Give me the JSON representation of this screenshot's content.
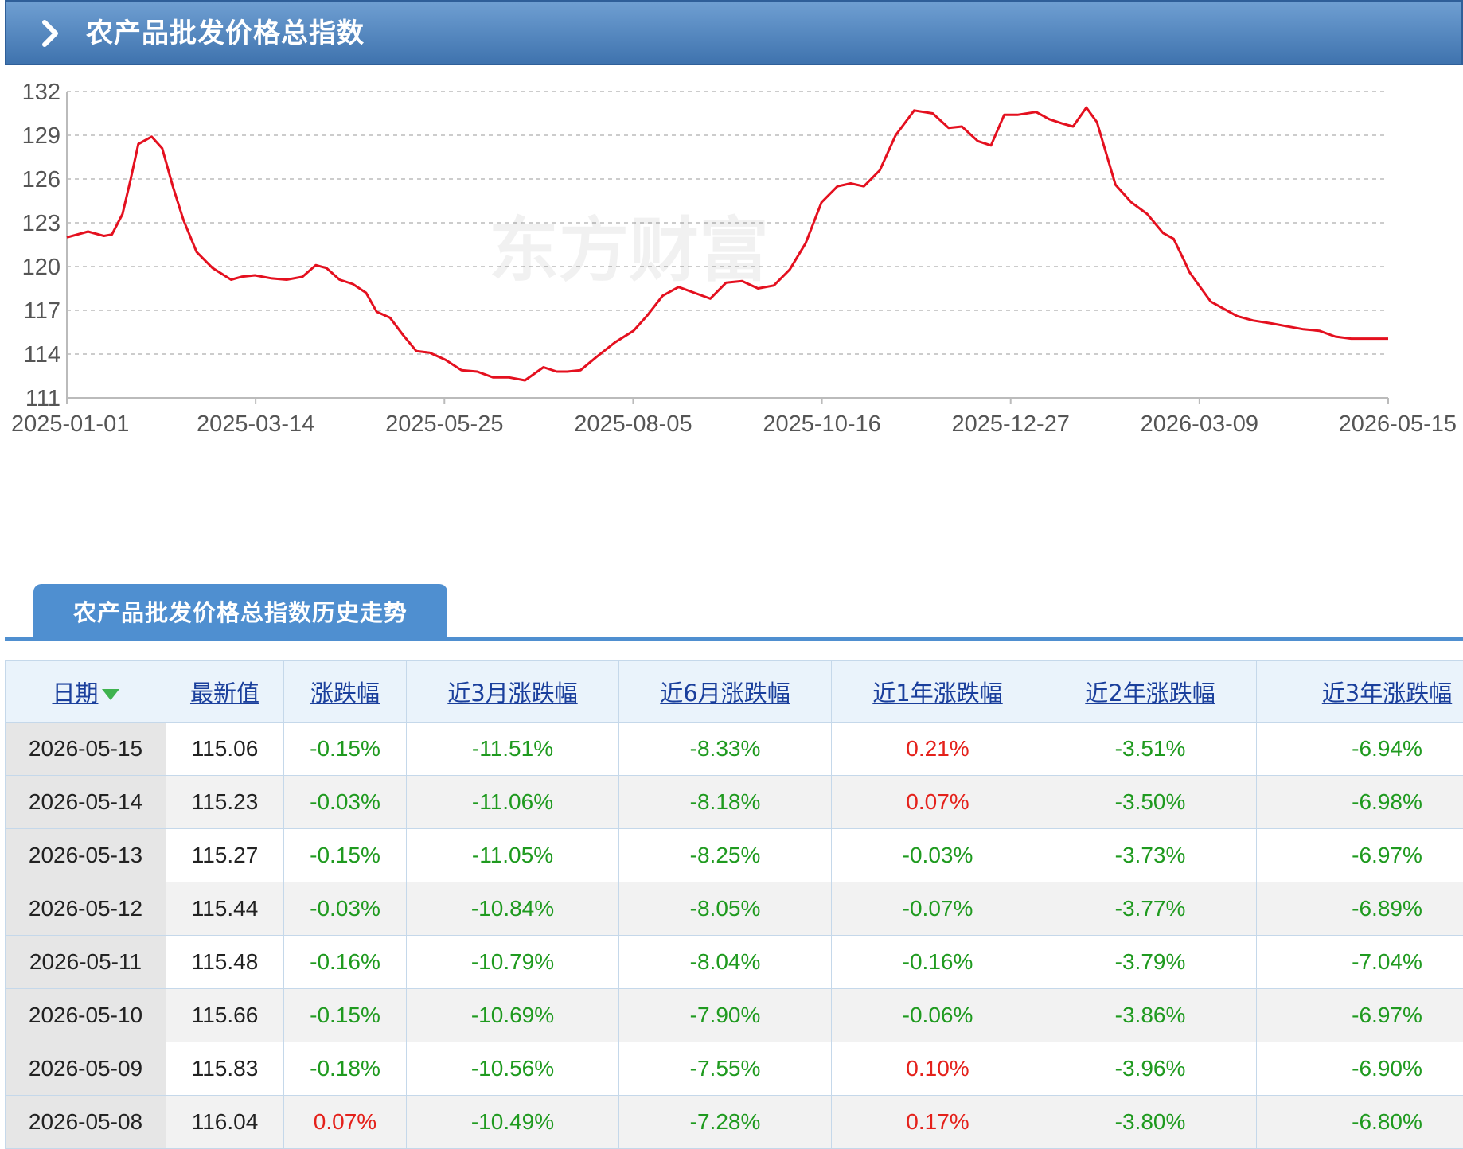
{
  "header": {
    "title": "农产品批发价格总指数"
  },
  "chart_data": {
    "type": "line",
    "title": "",
    "xlabel": "",
    "ylabel": "",
    "ylim": [
      111,
      132
    ],
    "yticks": [
      111,
      114,
      117,
      120,
      123,
      126,
      129,
      132
    ],
    "xticks": [
      "2025-01-01",
      "2025-03-14",
      "2025-05-25",
      "2025-08-05",
      "2025-10-16",
      "2025-12-27",
      "2026-03-09",
      "2026-05-15"
    ],
    "xlim": [
      "2025-01-01",
      "2026-05-15"
    ],
    "grid": true,
    "color": "#e4101f",
    "watermark": "东方财富",
    "series": [
      {
        "x": [
          "2025-01-01",
          "2025-01-09",
          "2025-01-15",
          "2025-01-18",
          "2025-01-22",
          "2025-01-25",
          "2025-01-28",
          "2025-02-02",
          "2025-02-06",
          "2025-02-10",
          "2025-02-14",
          "2025-02-19",
          "2025-02-25",
          "2025-03-04",
          "2025-03-08",
          "2025-03-13",
          "2025-03-19",
          "2025-03-25",
          "2025-03-31",
          "2025-04-05",
          "2025-04-09",
          "2025-04-14",
          "2025-04-19",
          "2025-04-24",
          "2025-04-28",
          "2025-05-03",
          "2025-05-08",
          "2025-05-13",
          "2025-05-18",
          "2025-05-24",
          "2025-05-30",
          "2025-06-05",
          "2025-06-11",
          "2025-06-17",
          "2025-06-23",
          "2025-06-30",
          "2025-07-05",
          "2025-07-09",
          "2025-07-14",
          "2025-07-20",
          "2025-07-27",
          "2025-08-03",
          "2025-08-08",
          "2025-08-14",
          "2025-08-20",
          "2025-08-26",
          "2025-09-01",
          "2025-09-07",
          "2025-09-13",
          "2025-09-19",
          "2025-09-25",
          "2025-10-01",
          "2025-10-07",
          "2025-10-13",
          "2025-10-19",
          "2025-10-24",
          "2025-10-29",
          "2025-11-04",
          "2025-11-10",
          "2025-11-17",
          "2025-11-24",
          "2025-11-30",
          "2025-12-05",
          "2025-12-11",
          "2025-12-16",
          "2025-12-21",
          "2025-12-26",
          "2026-01-02",
          "2026-01-07",
          "2026-01-12",
          "2026-01-16",
          "2026-01-21",
          "2026-01-25",
          "2026-02-01",
          "2026-02-07",
          "2026-02-13",
          "2026-02-19",
          "2026-02-23",
          "2026-02-27",
          "2026-03-01",
          "2026-03-05",
          "2026-03-09",
          "2026-03-14",
          "2026-03-19",
          "2026-03-25",
          "2026-04-01",
          "2026-04-07",
          "2026-04-13",
          "2026-04-19",
          "2026-04-25",
          "2026-05-01",
          "2026-05-06",
          "2026-05-10",
          "2026-05-15"
        ],
        "y": [
          122.0,
          122.4,
          122.1,
          122.2,
          123.6,
          125.9,
          128.4,
          128.9,
          128.1,
          125.5,
          123.2,
          121.0,
          119.9,
          119.1,
          119.3,
          119.4,
          119.2,
          119.1,
          119.3,
          120.1,
          119.9,
          119.1,
          118.8,
          118.2,
          116.9,
          116.5,
          115.3,
          114.2,
          114.1,
          113.6,
          112.9,
          112.8,
          112.4,
          112.4,
          112.2,
          113.1,
          112.8,
          112.8,
          112.9,
          113.8,
          114.8,
          115.6,
          116.6,
          118.0,
          118.6,
          118.2,
          117.8,
          118.9,
          119.0,
          118.5,
          118.7,
          119.8,
          121.6,
          124.4,
          125.5,
          125.7,
          125.5,
          126.6,
          129.0,
          130.7,
          130.5,
          129.5,
          129.6,
          128.6,
          128.3,
          130.4,
          130.4,
          130.6,
          130.1,
          129.8,
          129.6,
          130.9,
          129.9,
          125.6,
          124.4,
          123.6,
          122.3,
          121.9,
          120.4,
          119.6,
          118.6,
          117.6,
          117.1,
          116.6,
          116.3,
          116.1,
          115.9,
          115.7,
          115.6,
          115.2,
          115.06,
          115.06,
          115.06,
          115.06
        ]
      }
    ]
  },
  "tab": {
    "label": "农产品批发价格总指数历史走势"
  },
  "table": {
    "headers": [
      "日期",
      "最新值",
      "涨跌幅",
      "近3月涨跌幅",
      "近6月涨跌幅",
      "近1年涨跌幅",
      "近2年涨跌幅",
      "近3年涨跌幅"
    ],
    "sort_icon": "sort-down-arrow-icon",
    "colors": {
      "down": "#1f9a1f",
      "up": "#e4211b"
    },
    "rows": [
      {
        "date": "2026-05-15",
        "value": "115.06",
        "c1": "-0.15%",
        "c3m": "-11.51%",
        "c6m": "-8.33%",
        "c1y": "0.21%",
        "c2y": "-3.51%",
        "c3y": "-6.94%"
      },
      {
        "date": "2026-05-14",
        "value": "115.23",
        "c1": "-0.03%",
        "c3m": "-11.06%",
        "c6m": "-8.18%",
        "c1y": "0.07%",
        "c2y": "-3.50%",
        "c3y": "-6.98%"
      },
      {
        "date": "2026-05-13",
        "value": "115.27",
        "c1": "-0.15%",
        "c3m": "-11.05%",
        "c6m": "-8.25%",
        "c1y": "-0.03%",
        "c2y": "-3.73%",
        "c3y": "-6.97%"
      },
      {
        "date": "2026-05-12",
        "value": "115.44",
        "c1": "-0.03%",
        "c3m": "-10.84%",
        "c6m": "-8.05%",
        "c1y": "-0.07%",
        "c2y": "-3.77%",
        "c3y": "-6.89%"
      },
      {
        "date": "2026-05-11",
        "value": "115.48",
        "c1": "-0.16%",
        "c3m": "-10.79%",
        "c6m": "-8.04%",
        "c1y": "-0.16%",
        "c2y": "-3.79%",
        "c3y": "-7.04%"
      },
      {
        "date": "2026-05-10",
        "value": "115.66",
        "c1": "-0.15%",
        "c3m": "-10.69%",
        "c6m": "-7.90%",
        "c1y": "-0.06%",
        "c2y": "-3.86%",
        "c3y": "-6.97%"
      },
      {
        "date": "2026-05-09",
        "value": "115.83",
        "c1": "-0.18%",
        "c3m": "-10.56%",
        "c6m": "-7.55%",
        "c1y": "0.10%",
        "c2y": "-3.96%",
        "c3y": "-6.90%"
      },
      {
        "date": "2026-05-08",
        "value": "116.04",
        "c1": "0.07%",
        "c3m": "-10.49%",
        "c6m": "-7.28%",
        "c1y": "0.17%",
        "c2y": "-3.80%",
        "c3y": "-6.80%"
      }
    ]
  }
}
